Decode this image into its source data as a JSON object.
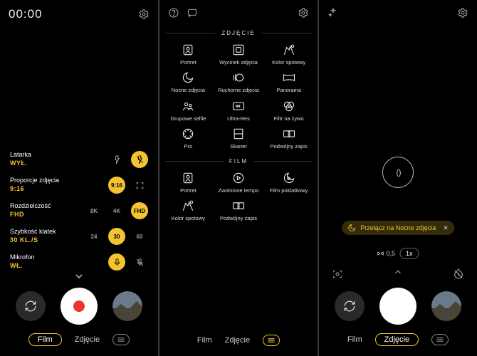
{
  "panel1": {
    "timer": "00:00",
    "settings": {
      "flash": {
        "label": "Latarka",
        "value": "WYŁ."
      },
      "ratio": {
        "label": "Proporcje zdjęcia",
        "value": "9:16",
        "opts": [
          "9:16"
        ]
      },
      "res": {
        "label": "Rozdzielczość",
        "value": "FHD",
        "opts": [
          "8K",
          "4K",
          "FHD"
        ]
      },
      "fps": {
        "label": "Szybkość klatek",
        "value": "30 KL./S",
        "opts": [
          "24",
          "30",
          "60"
        ]
      },
      "mic": {
        "label": "Mikrofon",
        "value": "WŁ."
      }
    },
    "tabs": {
      "film": "Film",
      "photo": "Zdjęcie",
      "active": "film"
    }
  },
  "panel2": {
    "section_photo": "ZDJĘCIE",
    "section_film": "FILM",
    "modes_photo": [
      {
        "id": "portret",
        "label": "Portret"
      },
      {
        "id": "wycinek",
        "label": "Wycinek zdjęcia"
      },
      {
        "id": "kolor",
        "label": "Kolor spotowy"
      },
      {
        "id": "nocne",
        "label": "Nocne zdjęcia"
      },
      {
        "id": "ruchome",
        "label": "Ruchome zdjęcia"
      },
      {
        "id": "panorama",
        "label": "Panorama"
      },
      {
        "id": "selfie",
        "label": "Grupowe selfie"
      },
      {
        "id": "ultrares",
        "label": "Ultra-Res"
      },
      {
        "id": "filtr",
        "label": "Filtr na żywo"
      },
      {
        "id": "pro",
        "label": "Pro"
      },
      {
        "id": "skaner",
        "label": "Skaner"
      },
      {
        "id": "podwojny",
        "label": "Podwójny zapis"
      }
    ],
    "modes_film": [
      {
        "id": "f_portret",
        "label": "Portret"
      },
      {
        "id": "f_slow",
        "label": "Zwolnione tempo"
      },
      {
        "id": "f_timelapse",
        "label": "Film poklatkowy"
      },
      {
        "id": "f_kolor",
        "label": "Kolor spotowy"
      },
      {
        "id": "f_podwojny",
        "label": "Podwójny zapis"
      }
    ],
    "tabs": {
      "film": "Film",
      "photo": "Zdjęcie",
      "active": "menu"
    }
  },
  "panel3": {
    "toast": "Przełącz na Nocne zdjęcia",
    "zoom": {
      "wide": "0,5",
      "main": "1x"
    },
    "tabs": {
      "film": "Film",
      "photo": "Zdjęcie",
      "active": "photo"
    }
  },
  "colors": {
    "accent": "#f4c430"
  }
}
